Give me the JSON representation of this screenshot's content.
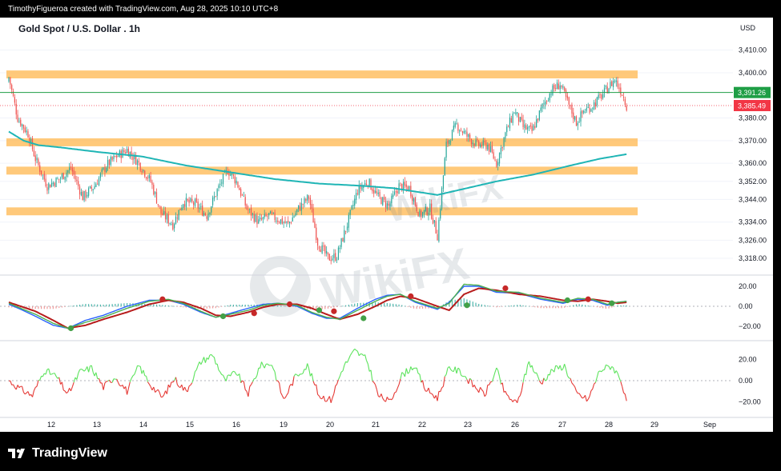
{
  "header": {
    "credit": "TimothyFigueroa created with TradingView.com, Aug 28, 2025 10:10 UTC+8",
    "symbol": "Gold Spot / U.S. Dollar . 1h"
  },
  "footer": {
    "brand": "TradingView",
    "logo_icon": "tradingview-logo-icon"
  },
  "watermark": {
    "text": "WikiFX",
    "icon": "wikifx-logo-icon"
  },
  "colors": {
    "up": "#26a69a",
    "down": "#ef5350",
    "zone": "#ffb74d",
    "ma": "#1fb5b5",
    "green_line": "#4caf50",
    "red_line": "#b71c1c",
    "blue_line": "#2962ff",
    "osc_green": "#5ce35c",
    "osc_red": "#e53935",
    "last_bg": "#f23645",
    "level_bg": "#1e9e45"
  },
  "chart_data": [
    {
      "type": "candlestick",
      "title": "Gold Spot / U.S. Dollar . 1h",
      "currency": "USD",
      "ylim": [
        3312,
        3418
      ],
      "yticks": [
        3410,
        3400,
        3380,
        3370,
        3360,
        3352,
        3344,
        3334,
        3326,
        3318
      ],
      "ytick_labels": [
        "3,410.00",
        "3,400.00",
        "3,380.00",
        "3,370.00",
        "3,360.00",
        "3,352.00",
        "3,344.00",
        "3,334.00",
        "3,326.00",
        "3,318.00"
      ],
      "x_labels": [
        "12",
        "13",
        "14",
        "15",
        "16",
        "19",
        "20",
        "21",
        "22",
        "23",
        "26",
        "27",
        "28",
        "29",
        "Sep"
      ],
      "price_labels": [
        {
          "value": 3391.26,
          "label": "3,391.26",
          "kind": "level"
        },
        {
          "value": 3385.49,
          "label": "3,385.49",
          "kind": "last"
        }
      ],
      "zones": [
        [
          3397.5,
          3401
        ],
        [
          3367.5,
          3371
        ],
        [
          3355,
          3358.5
        ],
        [
          3337,
          3340.5
        ]
      ],
      "close_anchors": [
        [
          0,
          3398
        ],
        [
          6,
          3380
        ],
        [
          13,
          3373
        ],
        [
          18,
          3362
        ],
        [
          26,
          3350
        ],
        [
          34,
          3353
        ],
        [
          42,
          3358
        ],
        [
          50,
          3345
        ],
        [
          58,
          3350
        ],
        [
          66,
          3359
        ],
        [
          73,
          3363
        ],
        [
          80,
          3366
        ],
        [
          88,
          3360
        ],
        [
          96,
          3352
        ],
        [
          103,
          3338
        ],
        [
          111,
          3333
        ],
        [
          118,
          3343
        ],
        [
          126,
          3342
        ],
        [
          134,
          3337
        ],
        [
          141,
          3348
        ],
        [
          148,
          3357
        ],
        [
          154,
          3352
        ],
        [
          161,
          3340
        ],
        [
          169,
          3334
        ],
        [
          176,
          3337
        ],
        [
          183,
          3335
        ],
        [
          189,
          3333
        ],
        [
          196,
          3340
        ],
        [
          203,
          3345
        ],
        [
          209,
          3325
        ],
        [
          216,
          3318
        ],
        [
          222,
          3319
        ],
        [
          229,
          3333
        ],
        [
          236,
          3348
        ],
        [
          243,
          3352
        ],
        [
          250,
          3345
        ],
        [
          257,
          3341
        ],
        [
          264,
          3350
        ],
        [
          271,
          3349
        ],
        [
          278,
          3337
        ],
        [
          285,
          3340
        ],
        [
          290,
          3328
        ],
        [
          296,
          3368
        ],
        [
          303,
          3377
        ],
        [
          310,
          3372
        ],
        [
          317,
          3368
        ],
        [
          324,
          3368
        ],
        [
          330,
          3360
        ],
        [
          336,
          3373
        ],
        [
          342,
          3383
        ],
        [
          348,
          3376
        ],
        [
          354,
          3374
        ],
        [
          361,
          3385
        ],
        [
          367,
          3392
        ],
        [
          373,
          3395
        ],
        [
          378,
          3387
        ],
        [
          384,
          3378
        ],
        [
          389,
          3383
        ],
        [
          394,
          3385
        ],
        [
          400,
          3389
        ],
        [
          405,
          3393
        ],
        [
          410,
          3397
        ],
        [
          415,
          3391
        ],
        [
          418,
          3385.5
        ]
      ],
      "ma200_anchors": [
        [
          0,
          3374
        ],
        [
          10,
          3370
        ],
        [
          20,
          3368
        ],
        [
          35,
          3367
        ],
        [
          60,
          3365
        ],
        [
          90,
          3363
        ],
        [
          120,
          3359
        ],
        [
          150,
          3356
        ],
        [
          180,
          3353
        ],
        [
          210,
          3351
        ],
        [
          240,
          3350
        ],
        [
          260,
          3349
        ],
        [
          290,
          3346
        ],
        [
          310,
          3349
        ],
        [
          330,
          3352
        ],
        [
          355,
          3355
        ],
        [
          380,
          3359
        ],
        [
          400,
          3362
        ],
        [
          418,
          3364
        ]
      ]
    },
    {
      "type": "line",
      "name": "momentum",
      "ylim": [
        -28,
        28
      ],
      "yticks": [
        20,
        0,
        -20
      ],
      "ytick_labels": [
        "20.00",
        "0.00",
        "−20.00"
      ],
      "green_anchors": [
        [
          0,
          3
        ],
        [
          8,
          -2
        ],
        [
          18,
          -8
        ],
        [
          30,
          -17
        ],
        [
          40,
          -22
        ],
        [
          52,
          -16
        ],
        [
          64,
          -11
        ],
        [
          80,
          -2
        ],
        [
          95,
          5
        ],
        [
          108,
          7
        ],
        [
          118,
          3
        ],
        [
          130,
          -5
        ],
        [
          140,
          -11
        ],
        [
          150,
          -8
        ],
        [
          162,
          -4
        ],
        [
          172,
          1
        ],
        [
          182,
          3
        ],
        [
          195,
          1
        ],
        [
          205,
          -6
        ],
        [
          215,
          -11
        ],
        [
          224,
          -13
        ],
        [
          236,
          -4
        ],
        [
          248,
          5
        ],
        [
          256,
          10
        ],
        [
          265,
          12
        ],
        [
          275,
          5
        ],
        [
          290,
          -2
        ],
        [
          298,
          3
        ],
        [
          308,
          22
        ],
        [
          318,
          21
        ],
        [
          330,
          15
        ],
        [
          345,
          14
        ],
        [
          360,
          8
        ],
        [
          375,
          4
        ],
        [
          385,
          8
        ],
        [
          395,
          7
        ],
        [
          405,
          2
        ],
        [
          412,
          4
        ],
        [
          418,
          5
        ]
      ],
      "red_anchors": [
        [
          0,
          4
        ],
        [
          8,
          0
        ],
        [
          18,
          -5
        ],
        [
          30,
          -14
        ],
        [
          40,
          -22
        ],
        [
          52,
          -19
        ],
        [
          64,
          -13
        ],
        [
          80,
          -6
        ],
        [
          95,
          2
        ],
        [
          108,
          6
        ],
        [
          118,
          4
        ],
        [
          130,
          -2
        ],
        [
          140,
          -9
        ],
        [
          150,
          -10
        ],
        [
          162,
          -6
        ],
        [
          172,
          -1
        ],
        [
          182,
          2
        ],
        [
          195,
          2
        ],
        [
          205,
          -2
        ],
        [
          215,
          -8
        ],
        [
          224,
          -13
        ],
        [
          236,
          -8
        ],
        [
          248,
          0
        ],
        [
          256,
          6
        ],
        [
          265,
          10
        ],
        [
          275,
          8
        ],
        [
          290,
          0
        ],
        [
          298,
          -4
        ],
        [
          308,
          12
        ],
        [
          318,
          18
        ],
        [
          330,
          16
        ],
        [
          345,
          12
        ],
        [
          360,
          10
        ],
        [
          375,
          6
        ],
        [
          385,
          5
        ],
        [
          395,
          7
        ],
        [
          405,
          5
        ],
        [
          412,
          3
        ],
        [
          418,
          4
        ]
      ],
      "blue_anchors": [
        [
          0,
          2
        ],
        [
          8,
          -3
        ],
        [
          18,
          -10
        ],
        [
          30,
          -19
        ],
        [
          40,
          -22
        ],
        [
          52,
          -14
        ],
        [
          64,
          -9
        ],
        [
          80,
          0
        ],
        [
          95,
          6
        ],
        [
          108,
          6
        ],
        [
          118,
          2
        ],
        [
          130,
          -6
        ],
        [
          140,
          -11
        ],
        [
          150,
          -7
        ],
        [
          162,
          -2
        ],
        [
          172,
          2
        ],
        [
          182,
          3
        ],
        [
          195,
          0
        ],
        [
          205,
          -7
        ],
        [
          215,
          -12
        ],
        [
          224,
          -12
        ],
        [
          236,
          -2
        ],
        [
          248,
          7
        ],
        [
          256,
          11
        ],
        [
          265,
          12
        ],
        [
          275,
          4
        ],
        [
          290,
          -3
        ],
        [
          298,
          4
        ],
        [
          308,
          20
        ],
        [
          318,
          20
        ],
        [
          330,
          14
        ],
        [
          345,
          13
        ],
        [
          360,
          7
        ],
        [
          375,
          3
        ],
        [
          385,
          7
        ],
        [
          395,
          6
        ],
        [
          405,
          1
        ],
        [
          412,
          4
        ],
        [
          418,
          5
        ]
      ],
      "signal_dots": [
        {
          "x": 42,
          "y": -22,
          "kind": "buy"
        },
        {
          "x": 104,
          "y": 7,
          "kind": "sell"
        },
        {
          "x": 145,
          "y": -10,
          "kind": "buy"
        },
        {
          "x": 166,
          "y": -7,
          "kind": "sell"
        },
        {
          "x": 190,
          "y": 2,
          "kind": "sell"
        },
        {
          "x": 210,
          "y": -4,
          "kind": "buy"
        },
        {
          "x": 220,
          "y": -5,
          "kind": "sell"
        },
        {
          "x": 240,
          "y": -12,
          "kind": "buy"
        },
        {
          "x": 272,
          "y": 10,
          "kind": "sell"
        },
        {
          "x": 310,
          "y": 1,
          "kind": "buy"
        },
        {
          "x": 336,
          "y": 18,
          "kind": "sell"
        },
        {
          "x": 378,
          "y": 6,
          "kind": "buy"
        },
        {
          "x": 392,
          "y": 7,
          "kind": "sell"
        },
        {
          "x": 408,
          "y": 3,
          "kind": "buy"
        }
      ]
    },
    {
      "type": "line",
      "name": "oscillator",
      "ylim": [
        -30,
        30
      ],
      "yticks": [
        20,
        0,
        -20
      ],
      "ytick_labels": [
        "20.00",
        "0.00",
        "−20.00"
      ],
      "anchors": [
        [
          0,
          0
        ],
        [
          8,
          -8
        ],
        [
          16,
          -14
        ],
        [
          24,
          10
        ],
        [
          32,
          4
        ],
        [
          40,
          -13
        ],
        [
          48,
          8
        ],
        [
          56,
          12
        ],
        [
          64,
          -6
        ],
        [
          72,
          4
        ],
        [
          80,
          -10
        ],
        [
          88,
          14
        ],
        [
          96,
          -4
        ],
        [
          104,
          -16
        ],
        [
          112,
          2
        ],
        [
          120,
          -10
        ],
        [
          130,
          18
        ],
        [
          138,
          24
        ],
        [
          146,
          0
        ],
        [
          154,
          8
        ],
        [
          162,
          -12
        ],
        [
          170,
          14
        ],
        [
          178,
          16
        ],
        [
          186,
          -18
        ],
        [
          194,
          4
        ],
        [
          202,
          14
        ],
        [
          210,
          -14
        ],
        [
          218,
          -18
        ],
        [
          226,
          12
        ],
        [
          234,
          28
        ],
        [
          242,
          20
        ],
        [
          250,
          -14
        ],
        [
          258,
          -20
        ],
        [
          266,
          5
        ],
        [
          274,
          14
        ],
        [
          282,
          -8
        ],
        [
          290,
          -16
        ],
        [
          298,
          12
        ],
        [
          306,
          8
        ],
        [
          314,
          -4
        ],
        [
          322,
          -13
        ],
        [
          330,
          10
        ],
        [
          336,
          -13
        ],
        [
          344,
          -22
        ],
        [
          352,
          18
        ],
        [
          360,
          -2
        ],
        [
          368,
          10
        ],
        [
          376,
          14
        ],
        [
          384,
          -12
        ],
        [
          392,
          -18
        ],
        [
          400,
          10
        ],
        [
          408,
          14
        ],
        [
          414,
          2
        ],
        [
          418,
          -22
        ]
      ]
    }
  ]
}
